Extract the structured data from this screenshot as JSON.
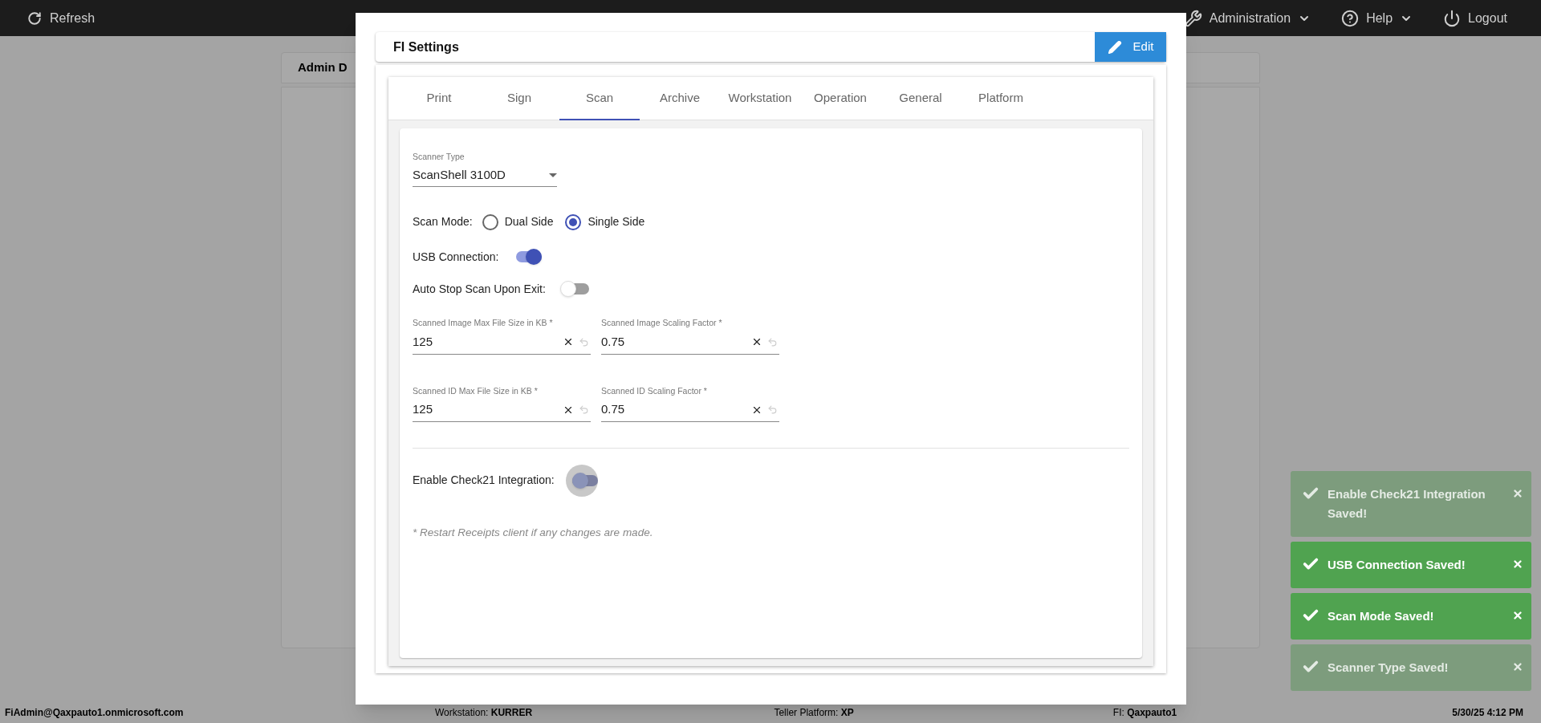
{
  "top_bar": {
    "refresh": {
      "label": "Refresh"
    },
    "menus": [
      {
        "label": "Administration",
        "dropdown": true
      },
      {
        "label": "Help",
        "dropdown": true
      },
      {
        "label": "Logout",
        "dropdown": false
      }
    ]
  },
  "background_card": {
    "title": "Admin D"
  },
  "modal": {
    "title": "FI Settings",
    "edit_button": "Edit",
    "tabs": [
      {
        "label": "Print",
        "selected": false
      },
      {
        "label": "Sign",
        "selected": false
      },
      {
        "label": "Scan",
        "selected": true
      },
      {
        "label": "Archive",
        "selected": false
      },
      {
        "label": "Workstation",
        "selected": false
      },
      {
        "label": "Operation",
        "selected": false
      },
      {
        "label": "General",
        "selected": false
      },
      {
        "label": "Platform",
        "selected": false
      }
    ],
    "scanner_type": {
      "label": "Scanner Type",
      "value": "ScanShell 3100D"
    },
    "scan_mode": {
      "label": "Scan Mode:",
      "options": [
        {
          "label": "Dual Side",
          "selected": false
        },
        {
          "label": "Single Side",
          "selected": true
        }
      ]
    },
    "toggles": [
      {
        "label": "USB Connection:",
        "on": true,
        "focused": false
      },
      {
        "label": "Auto Stop Scan Upon Exit:",
        "on": false,
        "focused": false
      }
    ],
    "fields": [
      {
        "label": "Scanned Image Max File Size in KB *",
        "value": "125"
      },
      {
        "label": "Scanned Image Scaling Factor *",
        "value": "0.75"
      },
      {
        "label": "Scanned ID Max File Size in KB *",
        "value": "125"
      },
      {
        "label": "Scanned ID Scaling Factor *",
        "value": "0.75"
      }
    ],
    "check21_toggle": {
      "label": "Enable Check21 Integration:",
      "on": false,
      "focused": true
    },
    "note": "* Restart Receipts client if any changes are made."
  },
  "toasts": [
    {
      "message": "Enable Check21 Integration Saved!",
      "faded": true
    },
    {
      "message": "USB Connection Saved!",
      "faded": false
    },
    {
      "message": "Scan Mode Saved!",
      "faded": false
    },
    {
      "message": "Scanner Type Saved!",
      "faded": true
    }
  ],
  "status_bar": {
    "user": "FiAdmin@Qaxpauto1.onmicrosoft.com",
    "items": [
      "Workstation: **KURRER**",
      "Teller Platform: **XP**",
      "FI: **Qaxpauto1**"
    ],
    "datetime": "5/30/25 4:12 PM"
  }
}
